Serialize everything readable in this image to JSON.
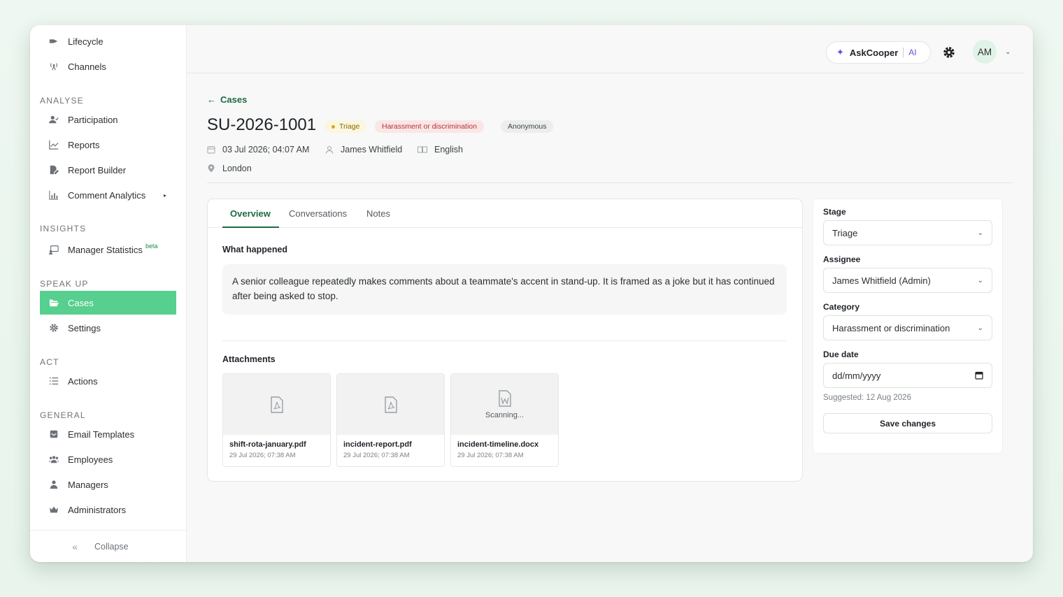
{
  "sidebar": {
    "top_items": [
      {
        "label": "Lifecycle",
        "icon": "lifecycle-icon"
      },
      {
        "label": "Channels",
        "icon": "broadcast-icon"
      }
    ],
    "sections": {
      "analyse": {
        "label": "ANALYSE",
        "items": [
          {
            "label": "Participation",
            "icon": "user-check-icon"
          },
          {
            "label": "Reports",
            "icon": "chart-line-icon"
          },
          {
            "label": "Report Builder",
            "icon": "file-edit-icon"
          },
          {
            "label": "Comment Analytics",
            "icon": "bar-chart-icon"
          }
        ]
      },
      "insights": {
        "label": "INSIGHTS",
        "items": [
          {
            "label": "Manager Statistics",
            "sup": "beta",
            "icon": "presentation-icon"
          }
        ]
      },
      "speakup": {
        "label": "SPEAK UP",
        "items": [
          {
            "label": "Cases",
            "icon": "folder-open-icon"
          },
          {
            "label": "Settings",
            "icon": "gear-icon"
          }
        ]
      },
      "act": {
        "label": "ACT",
        "items": [
          {
            "label": "Actions",
            "icon": "list-icon"
          }
        ]
      },
      "general": {
        "label": "GENERAL",
        "items": [
          {
            "label": "Email Templates",
            "icon": "envelope-icon"
          },
          {
            "label": "Employees",
            "icon": "users-icon"
          },
          {
            "label": "Managers",
            "icon": "user-tie-icon"
          },
          {
            "label": "Administrators",
            "icon": "crown-icon"
          }
        ]
      }
    },
    "collapse_label": "Collapse"
  },
  "topbar": {
    "askcooper_label": "AskCooper",
    "askcooper_ai": "AI",
    "avatar_initials": "AM"
  },
  "case": {
    "back_label": "Cases",
    "id": "SU-2026-1001",
    "stage_badge": "Triage",
    "category_badge": "Harassment or discrimination",
    "anonymity_badge": "Anonymous",
    "datetime": "03 Jul 2026; 04:07 AM",
    "reporter": "James Whitfield",
    "language": "English",
    "location": "London"
  },
  "tabs": [
    "Overview",
    "Conversations",
    "Notes"
  ],
  "overview": {
    "what_happened_label": "What happened",
    "description": "A senior colleague repeatedly makes comments about a teammate's accent in stand-up. It is framed as a joke but it has continued after being asked to stop.",
    "attachments_label": "Attachments",
    "attachments": [
      {
        "name": "shift-rota-january.pdf",
        "date": "29 Jul 2026; 07:38 AM",
        "status": ""
      },
      {
        "name": "incident-report.pdf",
        "date": "29 Jul 2026; 07:38 AM",
        "status": ""
      },
      {
        "name": "incident-timeline.docx",
        "date": "29 Jul 2026; 07:38 AM",
        "status": "Scanning..."
      }
    ]
  },
  "panel": {
    "stage_label": "Stage",
    "stage_value": "Triage",
    "assignee_label": "Assignee",
    "assignee_value": "James Whitfield (Admin)",
    "category_label": "Category",
    "category_value": "Harassment or discrimination",
    "due_label": "Due date",
    "due_placeholder": "dd/mm/yyyy",
    "suggested": "Suggested: 12 Aug 2026",
    "save_label": "Save changes"
  },
  "colors": {
    "accent": "#57cf8e",
    "brand_dark": "#1e6b43",
    "ai_purple": "#6a4bd9"
  }
}
